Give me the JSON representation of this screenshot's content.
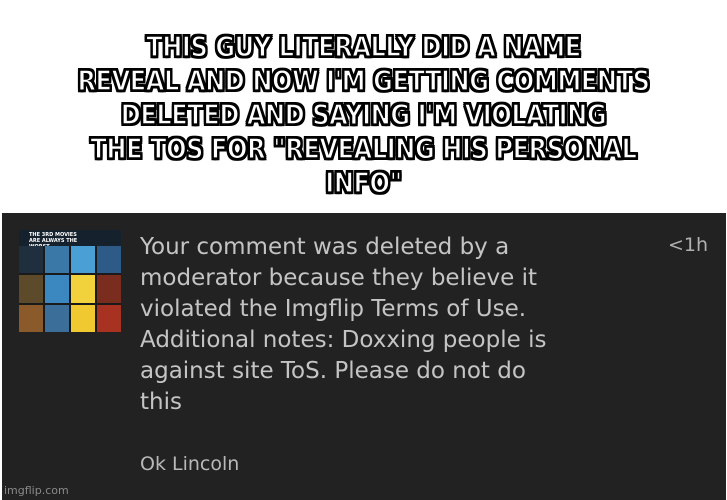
{
  "caption": {
    "text": "THIS GUY LITERALLY DID A NAME\nREVEAL AND NOW I'M GETTING COMMENTS\nDELETED AND SAYING I'M VIOLATING\nTHE TOS FOR \"REVEALING HIS PERSONAL INFO\""
  },
  "notification": {
    "thumbnail_text": "THE 3RD MOVIES ARE ALWAYS THE WORST",
    "thumbnail_colors": [
      "#1f2f3e",
      "#3a78a8",
      "#4a9fd4",
      "#2d5a86",
      "#5c4a2a",
      "#3b88c0",
      "#f2d23c",
      "#7a2c1e",
      "#8a5a2a",
      "#3c6e9a",
      "#f0c830",
      "#a83222"
    ],
    "message": "Your comment was deleted by a\nmoderator because they believe it\nviolated the Imgflip Terms of Use.\nAdditional notes: Doxxing people is\nagainst site ToS. Please do not do\nthis",
    "time": "<1h",
    "author": "Ok Lincoln"
  },
  "watermark": "imgflip.com"
}
